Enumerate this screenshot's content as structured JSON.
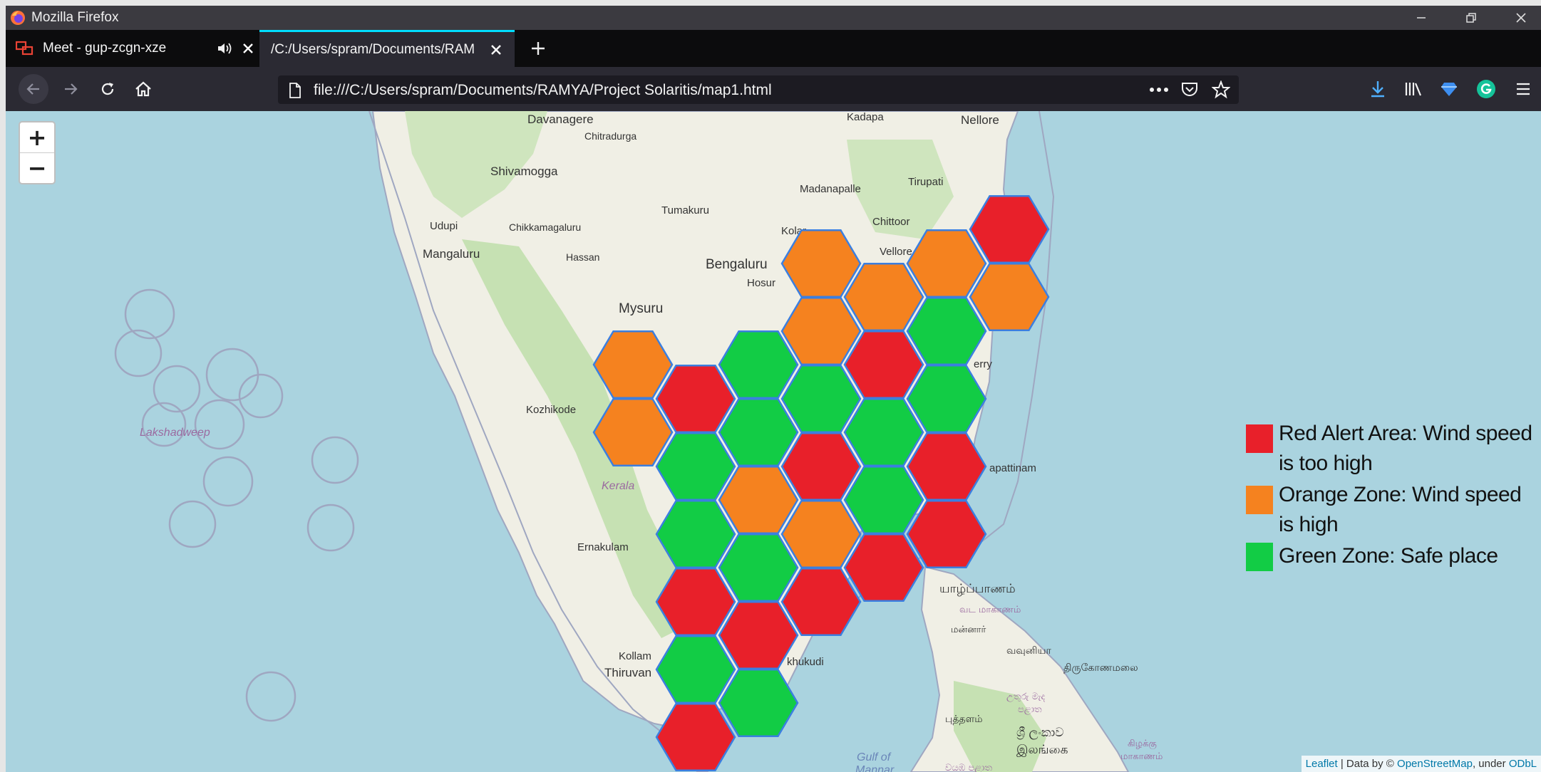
{
  "window": {
    "title": "Mozilla Firefox"
  },
  "tabs": [
    {
      "label": "Meet - gup-zcgn-xze",
      "audio": true
    },
    {
      "label": "/C:/Users/spram/Documents/RAM",
      "active": true
    }
  ],
  "urlbar": {
    "url": "file:///C:/Users/spram/Documents/RAMYA/Project Solaritis/map1.html"
  },
  "zoom": {
    "in_label": "+",
    "out_label": "−"
  },
  "legend": {
    "items": [
      {
        "color": "#e8202a",
        "label": "Red Alert Area: Wind speed is too high"
      },
      {
        "color": "#f5821f",
        "label": "Orange Zone: Wind speed is high"
      },
      {
        "color": "#12cc45",
        "label": "Green Zone: Safe place"
      }
    ]
  },
  "map_labels": {
    "davanagere": "Davanagere",
    "chitradurga": "Chitradurga",
    "shivamogga": "Shivamogga",
    "udupi": "Udupi",
    "chikkamagaluru": "Chikkamagaluru",
    "mangaluru": "Mangaluru",
    "hassan": "Hassan",
    "tumakuru": "Tumakuru",
    "madanapalle": "Madanapalle",
    "tirupati": "Tirupati",
    "kadapa": "Kadapa",
    "nellore": "Nellore",
    "kolar": "Kolar",
    "chittoor": "Chittoor",
    "vellore": "Vellore",
    "bengaluru": "Bengaluru",
    "hosur": "Hosur",
    "mysuru": "Mysuru",
    "kozhikode": "Kozhikode",
    "kerala": "Kerala",
    "ernakulam": "Ernakulam",
    "kollam": "Kollam",
    "thiruvan": "Thiruvan",
    "lakshadweep": "Lakshadweep",
    "erry": "erry",
    "apattinam": "apattinam",
    "khukudi": "khukudi",
    "gulf": "Gulf of",
    "mannar": "Mannar",
    "jaffna_ta": "யாழ்ப்பாணம்",
    "vada_ta": "வட மாகாணம்",
    "mannar_ta": "மன்னார்",
    "vavuniya_ta": "வவுனியா",
    "trinco_ta": "திருகோணமலை",
    "puttalam_ta": "புத்தளம்",
    "lanka_ta": "இலங்கை",
    "kilakku_ta": "கிழக்கு",
    "makanam_ta": "மாகாணம்",
    "sri_lanka_si": "ශ්‍රී ලංකාව",
    "uturu_si": "උතුරු මැද",
    "palata_si": "පළාත",
    "wayamba_si": "වයඹ පළාත"
  },
  "attribution": {
    "leaflet": "Leaflet",
    "data_by": " | Data by © ",
    "osm": "OpenStreetMap",
    "under": ", under ",
    "odbl": "ODbL"
  },
  "colors": {
    "red": "#e8202a",
    "orange": "#f5821f",
    "green": "#12cc45",
    "hex_stroke": "#3b7fe0"
  }
}
